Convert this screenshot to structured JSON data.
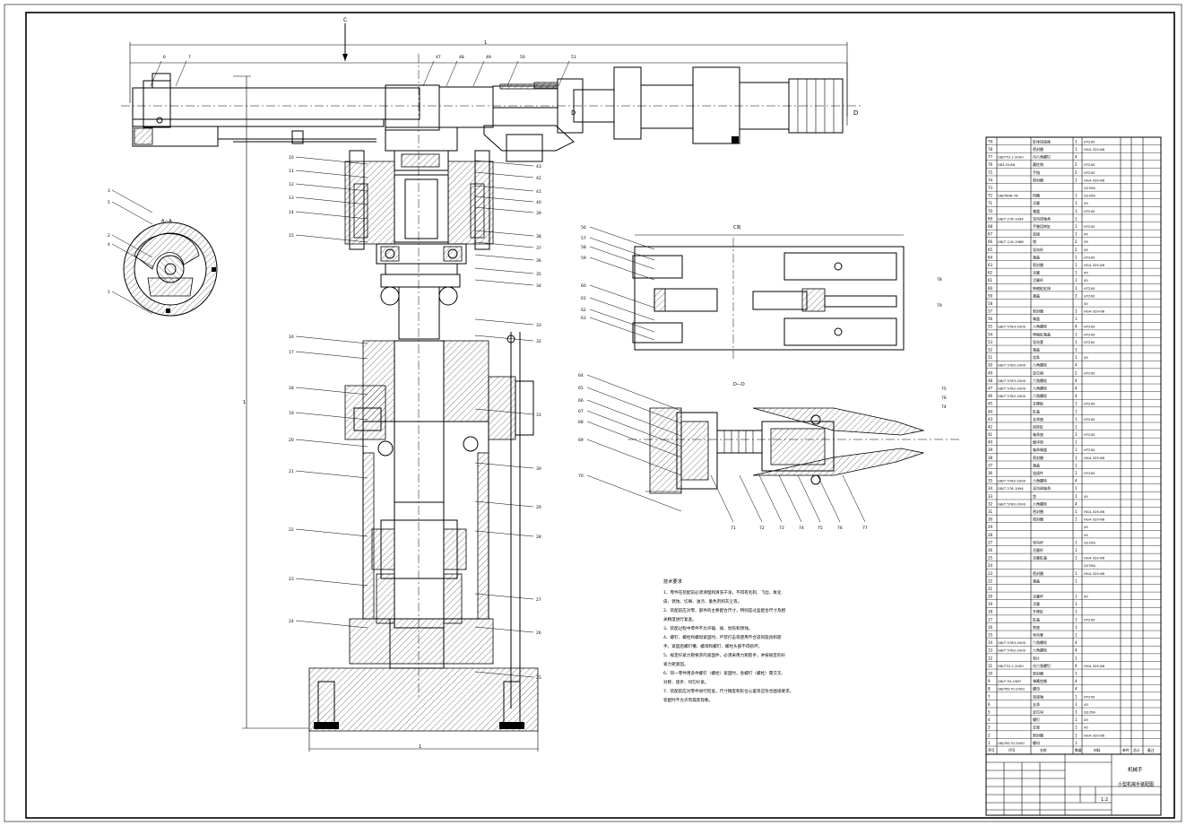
{
  "drawing": {
    "section_labels": {
      "main_top": "C",
      "aa_view": "A—A",
      "cc_view": "C向",
      "dd_view": "D—D",
      "d_marker": "D"
    },
    "notes": {
      "title": "技术要求",
      "lines": [
        "1、零件在装配前必须清理和清洗干净，不得有毛刺、飞边、氧化",
        "皮、锈蚀、切屑、油污、着色剂和灰尘等。",
        "2、装配前应对零、部件的主要配合尺寸，特别是过盈配合尺寸及相",
        "关精度进行复查。",
        "3、装配过程中零件不允许磕、碰、划伤和锈蚀。",
        "4、螺钉、螺栓和螺母紧固时，严禁打击或使用不合适的旋具和扳",
        "手，紧固后螺钉槽、螺母和螺钉、螺栓头部不得损坏。",
        "5、规定拧紧力矩要求的紧固件，必须采用力矩扳手，并按规定的拧",
        "紧力矩紧固。",
        "6、同一零件用多件螺钉（螺栓）紧固时，各螺钉（螺栓）需交叉、",
        "对称、逐步、均匀拧紧。",
        "7、装配前应对零件进行检查，尺寸精度和形位公差等应符合图纸要求。",
        "装配时不允许有漏装现象。"
      ]
    },
    "title_block": {
      "name": "机械手",
      "subtitle": "小型机械手装配图",
      "scale": "1:2",
      "header_cols": [
        "序号",
        "代号",
        "名称",
        "数量",
        "材料",
        "单件",
        "总计",
        "备注"
      ]
    },
    "parts": [
      {
        "no": "79",
        "code": "",
        "name": "缸体连接座",
        "qty": "1",
        "mat": "HT200"
      },
      {
        "no": "78",
        "code": "",
        "name": "密封圈",
        "qty": "1",
        "mat": "HG4-329-66"
      },
      {
        "no": "77",
        "code": "GB/T70.1-2000",
        "name": "内六角螺钉",
        "qty": "4",
        "mat": ""
      },
      {
        "no": "76",
        "code": "GB119-86",
        "name": "圆柱销",
        "qty": "2",
        "mat": "HT200"
      },
      {
        "no": "75",
        "code": "",
        "name": "手指",
        "qty": "2",
        "mat": "HT200"
      },
      {
        "no": "74",
        "code": "",
        "name": "密封圈",
        "qty": "1",
        "mat": "HG4-329-66"
      },
      {
        "no": "73",
        "code": "",
        "name": "",
        "qty": "",
        "mat": "Q235A"
      },
      {
        "no": "72",
        "code": "GB/T896-76",
        "name": "挡圈",
        "qty": "1",
        "mat": "Q235A"
      },
      {
        "no": "71",
        "code": "",
        "name": "活塞",
        "qty": "1",
        "mat": "45"
      },
      {
        "no": "70",
        "code": "",
        "name": "端盖",
        "qty": "1",
        "mat": "HT200"
      },
      {
        "no": "69",
        "code": "GB/T 276-1994",
        "name": "深沟球轴承",
        "qty": "1",
        "mat": ""
      },
      {
        "no": "68",
        "code": "",
        "name": "手腕回转缸",
        "qty": "1",
        "mat": "HT200"
      },
      {
        "no": "67",
        "code": "",
        "name": "连接",
        "qty": "1",
        "mat": "45"
      },
      {
        "no": "66",
        "code": "GB/T 119-1986",
        "name": "销",
        "qty": "2",
        "mat": "35"
      },
      {
        "no": "65",
        "code": "",
        "name": "导向杆",
        "qty": "2",
        "mat": "45"
      },
      {
        "no": "64",
        "code": "",
        "name": "端盖",
        "qty": "1",
        "mat": "HT200"
      },
      {
        "no": "63",
        "code": "",
        "name": "密封圈",
        "qty": "1",
        "mat": "HG4-329-66"
      },
      {
        "no": "62",
        "code": "",
        "name": "活塞",
        "qty": "1",
        "mat": "45"
      },
      {
        "no": "61",
        "code": "",
        "name": "活塞杆",
        "qty": "1",
        "mat": "45"
      },
      {
        "no": "60",
        "code": "",
        "name": "伸缩缸缸体",
        "qty": "1",
        "mat": "HT200"
      },
      {
        "no": "59",
        "code": "",
        "name": "端盖",
        "qty": "1",
        "mat": "HT200"
      },
      {
        "no": "58",
        "code": "",
        "name": "",
        "qty": "",
        "mat": "45"
      },
      {
        "no": "57",
        "code": "",
        "name": "密封圈",
        "qty": "1",
        "mat": "HG4-329-66"
      },
      {
        "no": "56",
        "code": "",
        "name": "端盖",
        "qty": "1",
        "mat": ""
      },
      {
        "no": "55",
        "code": "GB/T 5783-2000",
        "name": "六角螺栓",
        "qty": "4",
        "mat": "HT200"
      },
      {
        "no": "54",
        "code": "",
        "name": "伸缩缸端盖",
        "qty": "1",
        "mat": "HT200"
      },
      {
        "no": "53",
        "code": "",
        "name": "导向套",
        "qty": "1",
        "mat": "HT200"
      },
      {
        "no": "52",
        "code": "",
        "name": "端盖",
        "qty": "1",
        "mat": ""
      },
      {
        "no": "51",
        "code": "",
        "name": "齿条",
        "qty": "1",
        "mat": "45"
      },
      {
        "no": "50",
        "code": "GB/T 5782-2000",
        "name": "六角螺栓",
        "qty": "4",
        "mat": ""
      },
      {
        "no": "49",
        "code": "",
        "name": "定位销",
        "qty": "2",
        "mat": "HT200"
      },
      {
        "no": "48",
        "code": "GB/T 5783-2000",
        "name": "六角螺栓",
        "qty": "4",
        "mat": ""
      },
      {
        "no": "47",
        "code": "GB/T 5782-2000",
        "name": "六角螺栓",
        "qty": "4",
        "mat": ""
      },
      {
        "no": "46",
        "code": "GB/T 5782-2000",
        "name": "六角螺栓",
        "qty": "4",
        "mat": ""
      },
      {
        "no": "45",
        "code": "",
        "name": "支撑板",
        "qty": "1",
        "mat": "HT200"
      },
      {
        "no": "44",
        "code": "",
        "name": "缸盖",
        "qty": "1",
        "mat": ""
      },
      {
        "no": "43",
        "code": "",
        "name": "支承座",
        "qty": "1",
        "mat": "HT200"
      },
      {
        "no": "42",
        "code": "",
        "name": "回转缸",
        "qty": "1",
        "mat": ""
      },
      {
        "no": "41",
        "code": "",
        "name": "轴承座",
        "qty": "1",
        "mat": "HT200"
      },
      {
        "no": "40",
        "code": "",
        "name": "缓冲垫",
        "qty": "1",
        "mat": ""
      },
      {
        "no": "39",
        "code": "",
        "name": "轴承端盖",
        "qty": "1",
        "mat": "HT200"
      },
      {
        "no": "38",
        "code": "",
        "name": "密封圈",
        "qty": "1",
        "mat": "HG4-329-66"
      },
      {
        "no": "37",
        "code": "",
        "name": "端盖",
        "qty": "1",
        "mat": ""
      },
      {
        "no": "36",
        "code": "",
        "name": "连接件",
        "qty": "1",
        "mat": "HT200"
      },
      {
        "no": "35",
        "code": "GB/T 5782-2000",
        "name": "六角螺栓",
        "qty": "4",
        "mat": ""
      },
      {
        "no": "34",
        "code": "GB/T 276-1994",
        "name": "深沟球轴承",
        "qty": "1",
        "mat": ""
      },
      {
        "no": "33",
        "code": "",
        "name": "垫",
        "qty": "1",
        "mat": "45"
      },
      {
        "no": "32",
        "code": "GB/T 5782-2000",
        "name": "六角螺栓",
        "qty": "4",
        "mat": ""
      },
      {
        "no": "31",
        "code": "",
        "name": "密封圈",
        "qty": "1",
        "mat": "HG4-329-66"
      },
      {
        "no": "30",
        "code": "",
        "name": "密封圈",
        "qty": "1",
        "mat": "HG4-329-66"
      },
      {
        "no": "29",
        "code": "",
        "name": "",
        "qty": "",
        "mat": "45"
      },
      {
        "no": "28",
        "code": "",
        "name": "",
        "qty": "",
        "mat": "45"
      },
      {
        "no": "27",
        "code": "",
        "name": "导向杆",
        "qty": "1",
        "mat": "Q235A"
      },
      {
        "no": "26",
        "code": "",
        "name": "活塞杆",
        "qty": "1",
        "mat": ""
      },
      {
        "no": "25",
        "code": "",
        "name": "活塞缸盖",
        "qty": "1",
        "mat": "HG4-329-66"
      },
      {
        "no": "24",
        "code": "",
        "name": "",
        "qty": "",
        "mat": "Q235A"
      },
      {
        "no": "23",
        "code": "",
        "name": "密封圈",
        "qty": "1",
        "mat": "HG4-329-66"
      },
      {
        "no": "22",
        "code": "",
        "name": "端盖",
        "qty": "1",
        "mat": ""
      },
      {
        "no": "21",
        "code": "",
        "name": "",
        "qty": "",
        "mat": ""
      },
      {
        "no": "20",
        "code": "",
        "name": "活塞杆",
        "qty": "1",
        "mat": "45"
      },
      {
        "no": "19",
        "code": "",
        "name": "活塞",
        "qty": "1",
        "mat": ""
      },
      {
        "no": "18",
        "code": "",
        "name": "升降缸",
        "qty": "1",
        "mat": ""
      },
      {
        "no": "17",
        "code": "",
        "name": "缸盖",
        "qty": "1",
        "mat": "HT200"
      },
      {
        "no": "16",
        "code": "",
        "name": "底座",
        "qty": "1",
        "mat": ""
      },
      {
        "no": "15",
        "code": "",
        "name": "导向套",
        "qty": "1",
        "mat": ""
      },
      {
        "no": "14",
        "code": "GB/T 5783-2000",
        "name": "六角螺栓",
        "qty": "4",
        "mat": ""
      },
      {
        "no": "13",
        "code": "GB/T 5782-2000",
        "name": "六角螺栓",
        "qty": "4",
        "mat": ""
      },
      {
        "no": "12",
        "code": "",
        "name": "垫片",
        "qty": "1",
        "mat": ""
      },
      {
        "no": "11",
        "code": "GB/T70.1-2000",
        "name": "内六角螺钉",
        "qty": "4",
        "mat": "HG4-329-66"
      },
      {
        "no": "10",
        "code": "",
        "name": "密封圈",
        "qty": "1",
        "mat": ""
      },
      {
        "no": "9",
        "code": "GB/T 93-1987",
        "name": "弹簧垫圈",
        "qty": "4",
        "mat": ""
      },
      {
        "no": "8",
        "code": "GB/T6170-2000",
        "name": "螺母",
        "qty": "4",
        "mat": ""
      },
      {
        "no": "7",
        "code": "",
        "name": "连接轴",
        "qty": "1",
        "mat": "HT200"
      },
      {
        "no": "6",
        "code": "",
        "name": "支承",
        "qty": "1",
        "mat": "45"
      },
      {
        "no": "5",
        "code": "",
        "name": "定位块",
        "qty": "1",
        "mat": "Q235A"
      },
      {
        "no": "4",
        "code": "",
        "name": "螺钉",
        "qty": "1",
        "mat": "45"
      },
      {
        "no": "3",
        "code": "",
        "name": "支架",
        "qty": "1",
        "mat": "45"
      },
      {
        "no": "2",
        "code": "",
        "name": "密封圈",
        "qty": "1",
        "mat": "HG4-329-66"
      },
      {
        "no": "1",
        "code": "GB/T6170-2000",
        "name": "螺母",
        "qty": "1",
        "mat": ""
      }
    ],
    "balloons_left": [
      "10",
      "11",
      "12",
      "13",
      "14",
      "15",
      "16",
      "17",
      "18",
      "19",
      "20",
      "21",
      "22",
      "23",
      "24"
    ],
    "balloons_right": [
      "43",
      "42",
      "41",
      "40",
      "39",
      "38",
      "37",
      "36",
      "35",
      "34",
      "33",
      "32",
      "31",
      "30",
      "29",
      "28",
      "27",
      "26",
      "25"
    ],
    "balloons_top": [
      "6",
      "7",
      "47",
      "48",
      "49",
      "50",
      "51"
    ],
    "balloons_aa": [
      "3",
      "5",
      "2",
      "4",
      "1"
    ],
    "balloons_c": [
      "56",
      "57",
      "58",
      "59",
      "60",
      "61",
      "62",
      "63"
    ],
    "balloons_d": [
      "64",
      "65",
      "66",
      "67",
      "68",
      "69",
      "70",
      "71",
      "72",
      "73",
      "74",
      "75",
      "76",
      "77",
      "78",
      "79"
    ]
  }
}
